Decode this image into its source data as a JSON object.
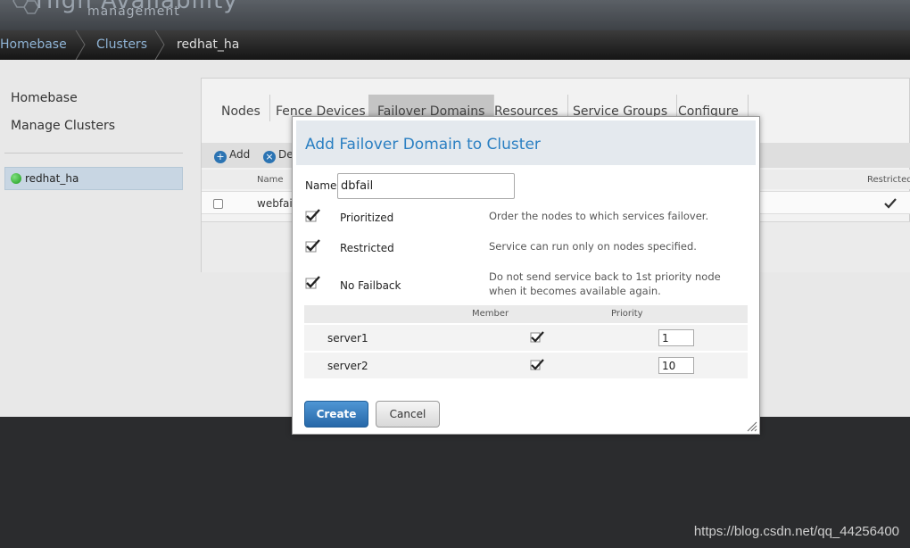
{
  "header": {
    "app_title": "High Availability",
    "app_subtitle": "management"
  },
  "breadcrumb": {
    "items": [
      "Homebase",
      "Clusters",
      "redhat_ha"
    ]
  },
  "sidebar": {
    "links": [
      "Homebase",
      "Manage Clusters"
    ],
    "cluster": {
      "name": "redhat_ha",
      "status_color": "#22a022"
    }
  },
  "content": {
    "tabs": [
      {
        "label": "Nodes"
      },
      {
        "label": "Fence Devices"
      },
      {
        "label": "Failover Domains",
        "active": true
      },
      {
        "label": "Resources"
      },
      {
        "label": "Service Groups"
      },
      {
        "label": "Configure"
      }
    ],
    "toolbar": {
      "add_label": "Add",
      "delete_label": "De"
    },
    "table": {
      "columns": [
        "Name",
        "Restricted"
      ],
      "rows": [
        {
          "name": "webfail",
          "restricted": true
        }
      ]
    }
  },
  "modal": {
    "title": "Add Failover Domain to Cluster",
    "name_label": "Name",
    "name_value": "dbfail",
    "options": [
      {
        "label": "Prioritized",
        "checked": true,
        "description": "Order the nodes to which services failover."
      },
      {
        "label": "Restricted",
        "checked": true,
        "description": "Service can run only on nodes specified."
      },
      {
        "label": "No Failback",
        "checked": true,
        "description": "Do not send service back to 1st priority node when it becomes available again."
      }
    ],
    "member_table": {
      "columns": [
        "Member",
        "Priority"
      ],
      "rows": [
        {
          "node": "server1",
          "member": true,
          "priority": "1"
        },
        {
          "node": "server2",
          "member": true,
          "priority": "10"
        }
      ]
    },
    "create_label": "Create",
    "cancel_label": "Cancel"
  },
  "watermark": "https://blog.csdn.net/qq_44256400",
  "colors": {
    "accent": "#2a7fc2",
    "primary_button": "#2f75b5",
    "footer": "#2b2c2e"
  }
}
